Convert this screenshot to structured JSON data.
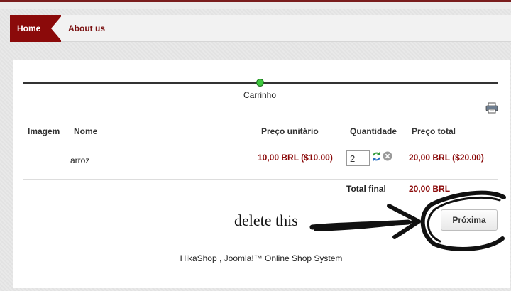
{
  "nav": {
    "home": "Home",
    "about": "About us"
  },
  "checkout": {
    "step_label": "Carrinho",
    "columns": {
      "image": "Imagem",
      "name": "Nome",
      "unit_price": "Preço unitário",
      "quantity": "Quantidade",
      "total_price": "Preço total"
    },
    "row": {
      "name": "arroz",
      "unit_price": "10,00 BRL ($10.00)",
      "quantity": "2",
      "total_price": "20,00 BRL ($20.00)"
    },
    "grand_total_label": "Total final",
    "grand_total_value": "20,00 BRL",
    "next_button": "Próxima"
  },
  "annotation": {
    "text": "delete this"
  },
  "footer": {
    "text": "HikaShop , Joomla!™ Online Shop System"
  },
  "colors": {
    "brand": "#8b0a0a",
    "step_active": "#3fc83f"
  },
  "icons": [
    "printer-icon",
    "refresh-icon",
    "remove-icon"
  ]
}
